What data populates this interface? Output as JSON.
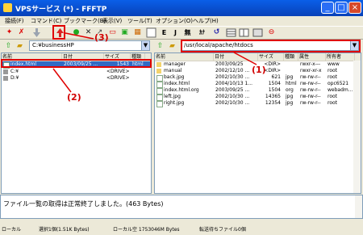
{
  "window": {
    "title": "VPSサービス (*) - FFFTP"
  },
  "menu": [
    "接続(F)",
    "コマンド(C)",
    "ブックマーク(B)",
    "表示(V)",
    "ツール(T)",
    "オプション(O)",
    "ヘルプ(H)"
  ],
  "toolbar": {
    "icons": [
      "connect-icon",
      "disconnect-icon",
      "download-icon",
      "upload-icon",
      "refresh-icon",
      "delete-icon",
      "rename-icon",
      "mkdir-icon",
      "local-cd-icon",
      "remote-cd-icon",
      "sjis-mode-icon",
      "jis-mode-icon",
      "euc-mode-icon",
      "no-convert-icon",
      "kana-icon",
      "sync-icon",
      "list-view-icon",
      "detail-view-icon",
      "filter-icon",
      "stop-icon"
    ],
    "kana_labels": {
      "eu": "E",
      "ju": "J",
      "none": "無",
      "kana": "ｶﾅ"
    }
  },
  "local": {
    "path": "C:¥businessHP",
    "headers": [
      "名前",
      "日付",
      "サイズ",
      "種類"
    ],
    "files": [
      {
        "name": "index.html",
        "date": "2003/09/25 ...",
        "size": "1543",
        "type": "html",
        "kind": "file"
      },
      {
        "name": "C:¥",
        "date": "",
        "size": "<DRIVE>",
        "type": "",
        "kind": "drive"
      },
      {
        "name": "D:¥",
        "date": "",
        "size": "<DRIVE>",
        "type": "",
        "kind": "drive"
      }
    ]
  },
  "remote": {
    "path": "/usr/local/apache/htdocs",
    "headers": [
      "名前",
      "日付",
      "サイズ",
      "種類",
      "属性",
      "所有者"
    ],
    "files": [
      {
        "name": "manager",
        "date": "2003/09/25",
        "size": "<DIR>",
        "type": "",
        "attr": "rwxr-x---",
        "owner": "www",
        "kind": "folder"
      },
      {
        "name": "manual",
        "date": "2002/12/10 ...",
        "size": "<DIR>",
        "type": "",
        "attr": "rwxr-xr-x",
        "owner": "root",
        "kind": "folder"
      },
      {
        "name": "back.jpg",
        "date": "2002/10/30 ...",
        "size": "621",
        "type": "jpg",
        "attr": "rw-rw-r--",
        "owner": "root",
        "kind": "file"
      },
      {
        "name": "index.html",
        "date": "2004/10/13 1...",
        "size": "1504",
        "type": "html",
        "attr": "rw-rw-r--",
        "owner": "opc6521",
        "kind": "file"
      },
      {
        "name": "index.html.org",
        "date": "2003/09/25 ...",
        "size": "1504",
        "type": "org",
        "attr": "rw-rw-r--",
        "owner": "webadm...",
        "kind": "file"
      },
      {
        "name": "left.jpg",
        "date": "2002/10/30 ...",
        "size": "14365",
        "type": "jpg",
        "attr": "rw-rw-r--",
        "owner": "root",
        "kind": "file"
      },
      {
        "name": "right.jpg",
        "date": "2002/10/30 ...",
        "size": "12354",
        "type": "jpg",
        "attr": "rw-rw-r--",
        "owner": "root",
        "kind": "file"
      }
    ]
  },
  "log": {
    "message": "ファイル一覧の取得は正常終了しました。(463 Bytes)"
  },
  "statusbar": {
    "mode": "ローカル",
    "selected": "選択1個(1.51K Bytes)",
    "free": "ローカル空 1753046M Bytes",
    "queue": "転送待ちファイル0個"
  },
  "annotations": {
    "callout1": "(1)",
    "callout2": "(2)",
    "callout3": "(3)"
  }
}
